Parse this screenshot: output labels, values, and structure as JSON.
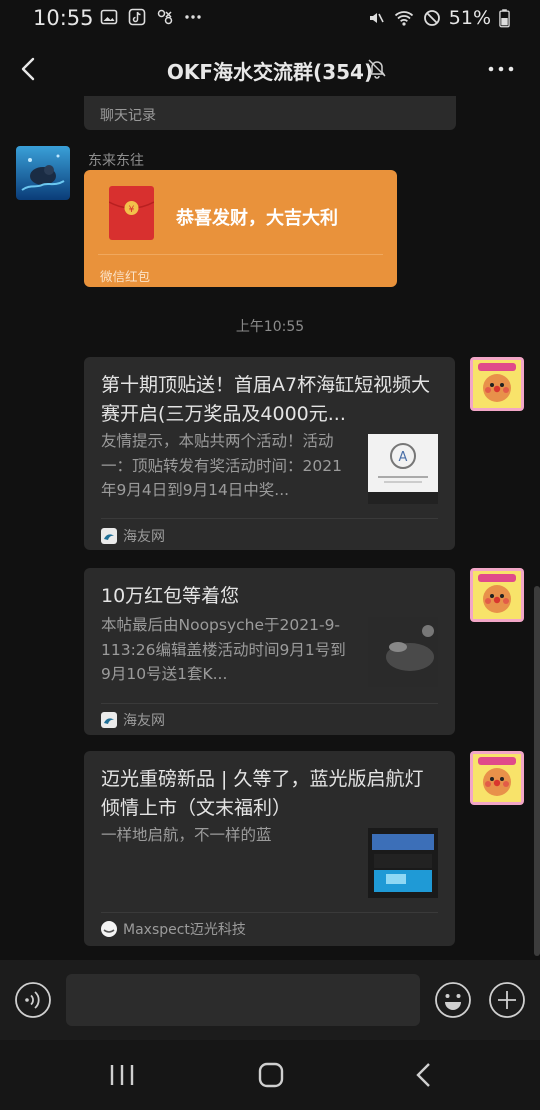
{
  "status_bar": {
    "time": "10:55",
    "battery": "51%",
    "left_icons": [
      "gallery-icon",
      "tiktok-icon",
      "app-notification-icon",
      "more-dots-icon"
    ],
    "right_icons": [
      "mute-icon",
      "wifi-icon",
      "dnd-icon",
      "battery-icon"
    ]
  },
  "nav": {
    "title": "OKF海水交流群(354)",
    "muted": true
  },
  "chat": {
    "history_label": "聊天记录",
    "messages": [
      {
        "type": "red_packet",
        "sender": "东来东往",
        "title": "恭喜发财，大吉大利",
        "footer": "微信红包"
      }
    ],
    "timestamp": "上午10:55",
    "link_cards": [
      {
        "title": "第十期顶贴送！首届A7杯海缸短视频大赛开启(三万奖品及4000元...",
        "description": "友情提示，本贴共两个活动！活动一：顶贴转发有奖活动时间：2021年9月4日到9月14日中奖...",
        "source": "海友网"
      },
      {
        "title": "10万红包等着您",
        "description": "本帖最后由Noopsyche于2021-9-113:26编辑盖楼活动时间9月1号到9月10号送1套K...",
        "source": "海友网"
      },
      {
        "title": "迈光重磅新品 | 久等了，蓝光版启航灯倾情上市（文末福利）",
        "description": "一样地启航，不一样的蓝",
        "source": "Maxspect迈光科技"
      }
    ]
  },
  "input_bar": {
    "value": "",
    "placeholder": ""
  },
  "colors": {
    "background": "#111111",
    "bubble": "#2b2b2b",
    "red_packet": "#e9923b",
    "red_envelope": "#d8302f"
  }
}
